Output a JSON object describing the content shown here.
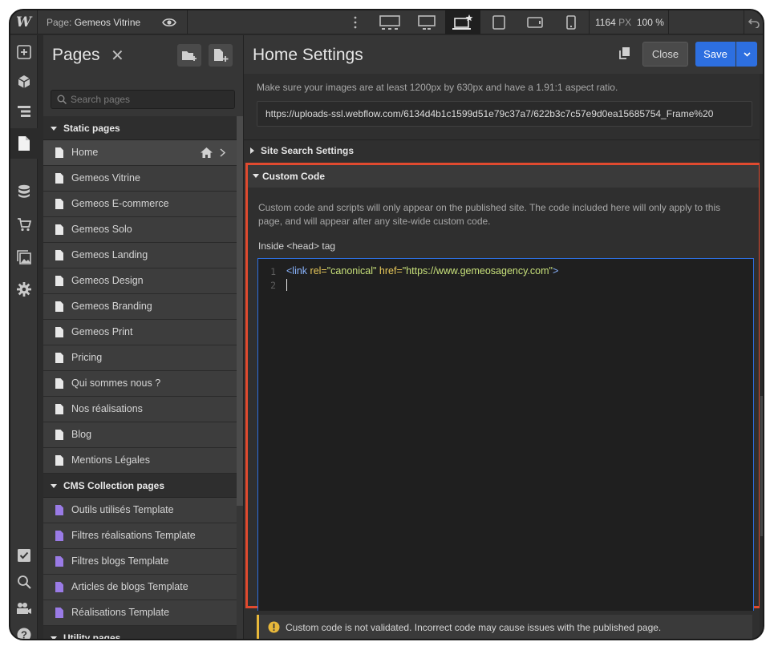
{
  "topbar": {
    "logo": "W",
    "page_prefix": "Page:",
    "page_name": "Gemeos Vitrine",
    "width_value": "1164",
    "width_unit": "PX",
    "zoom": "100 %"
  },
  "pages_panel": {
    "title": "Pages",
    "search_placeholder": "Search pages",
    "static_section": "Static pages",
    "static_pages": [
      "Home",
      "Gemeos Vitrine",
      "Gemeos E-commerce",
      "Gemeos Solo",
      "Gemeos Landing",
      "Gemeos Design",
      "Gemeos Branding",
      "Gemeos Print",
      "Pricing",
      "Qui sommes nous ?",
      "Nos réalisations",
      "Blog",
      "Mentions Légales"
    ],
    "cms_section": "CMS Collection pages",
    "cms_pages": [
      "Outils utilisés Template",
      "Filtres réalisations Template",
      "Filtres blogs Template",
      "Articles de blogs Template",
      "Réalisations Template"
    ],
    "utility_section": "Utility pages"
  },
  "settings": {
    "title": "Home Settings",
    "close_label": "Close",
    "save_label": "Save",
    "og_hint": "Make sure your images are at least 1200px by 630px and have a 1.91:1 aspect ratio.",
    "og_url": "https://uploads-ssl.webflow.com/6134d4b1c1599d51e79c37a7/622b3c7c57e9d0ea15685754_Frame%20",
    "site_search_section": "Site Search Settings",
    "custom_code_section": "Custom Code",
    "custom_code_desc": "Custom code and scripts will only appear on the published site. The code included here will only apply to this page, and will appear after any site-wide custom code.",
    "head_label": "Inside <head> tag",
    "code": {
      "line1_no": "1",
      "line2_no": "2",
      "tag_open": "<link ",
      "attr1": "rel=",
      "val1": "\"canonical\"",
      "attr2": " href=",
      "val2": "\"https://www.gemeosagency.com\"",
      "tag_close": ">"
    },
    "warning": "Custom code is not validated. Incorrect code may cause issues with the published page."
  },
  "colors": {
    "accent": "#2d6fe0",
    "highlight_border": "#e04a2f",
    "warning": "#e8b83a",
    "cms_icon": "#9a7be6"
  }
}
